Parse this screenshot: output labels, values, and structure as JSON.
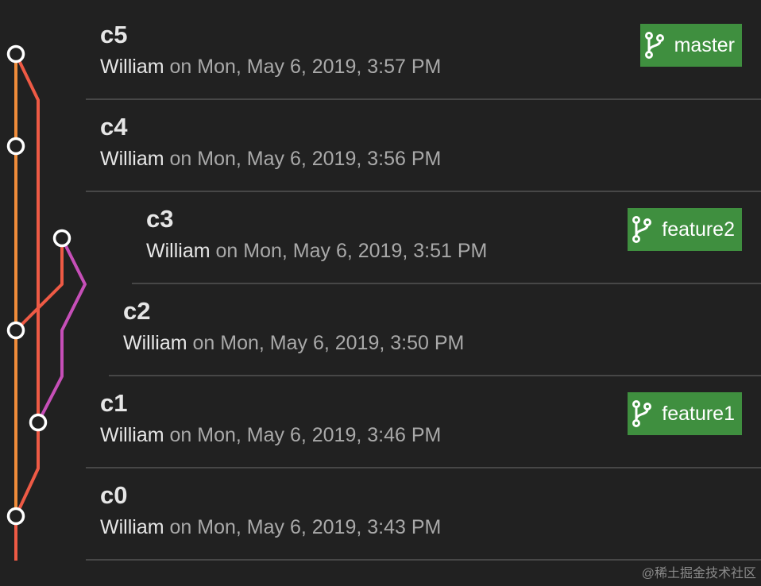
{
  "commits": [
    {
      "title": "c5",
      "author": "William",
      "meta": " on Mon, May 6, 2019, 3:57 PM",
      "branch": "master"
    },
    {
      "title": "c4",
      "author": "William",
      "meta": " on Mon, May 6, 2019, 3:56 PM",
      "branch": ""
    },
    {
      "title": "c3",
      "author": "William",
      "meta": " on Mon, May 6, 2019, 3:51 PM",
      "branch": "feature2"
    },
    {
      "title": "c2",
      "author": "William",
      "meta": " on Mon, May 6, 2019, 3:50 PM",
      "branch": ""
    },
    {
      "title": "c1",
      "author": "William",
      "meta": " on Mon, May 6, 2019, 3:46 PM",
      "branch": "feature1"
    },
    {
      "title": "c0",
      "author": "William",
      "meta": " on Mon, May 6, 2019, 3:43 PM",
      "branch": ""
    }
  ],
  "graph_colors": {
    "orange": "#f08c3a",
    "red": "#ee5a45",
    "purple": "#c64fb8",
    "node_fill": "#212121",
    "node_stroke": "#ffffff"
  },
  "branch_icon": "git-branch-icon",
  "watermark": "@稀土掘金技术社区"
}
